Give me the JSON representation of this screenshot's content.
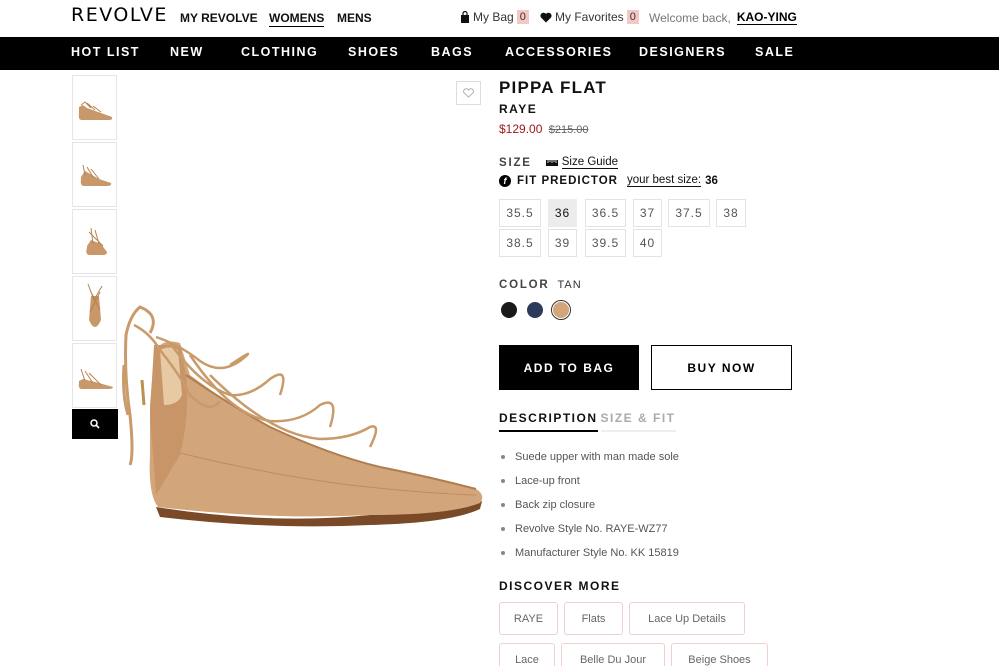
{
  "header": {
    "logo": "REVOLVE",
    "nav": {
      "my_revolve": "MY REVOLVE",
      "womens": "WOMENS",
      "mens": "MENS"
    },
    "bag_label": "My Bag",
    "bag_count": "0",
    "favorites_label": "My Favorites",
    "favorites_count": "0",
    "welcome_text": "Welcome back,",
    "username": "KAO-YING"
  },
  "categories": [
    "HOT LIST",
    "NEW",
    "CLOTHING",
    "SHOES",
    "BAGS",
    "ACCESSORIES",
    "DESIGNERS",
    "SALE"
  ],
  "product": {
    "title": "PIPPA FLAT",
    "brand": "RAYE",
    "sale_price": "$129.00",
    "original_price": "$215.00",
    "size_label": "SIZE",
    "size_guide": "Size Guide",
    "fit_predictor_label": "FIT PREDICTOR",
    "best_size_text": "your best size:",
    "best_size_value": "36",
    "sizes": [
      "35.5",
      "36",
      "36.5",
      "37",
      "37.5",
      "38",
      "38.5",
      "39",
      "39.5",
      "40"
    ],
    "selected_size": "36",
    "color_label": "COLOR",
    "color_value": "TAN",
    "swatches": [
      {
        "name": "black",
        "hex": "#1a1a1a"
      },
      {
        "name": "navy",
        "hex": "#2c3a5c"
      },
      {
        "name": "tan",
        "hex": "#d3a57a"
      }
    ],
    "selected_color": "tan",
    "add_to_bag": "ADD TO BAG",
    "buy_now": "BUY NOW",
    "tabs": [
      "DESCRIPTION",
      "SIZE & FIT"
    ],
    "description": [
      "Suede upper with man made sole",
      "Lace-up front",
      "Back zip closure",
      "Revolve Style No. RAYE-WZ77",
      "Manufacturer Style No. KK 15819"
    ],
    "discover_label": "DISCOVER MORE",
    "discover_tags": [
      "RAYE",
      "Flats",
      "Lace Up Details",
      "Lace",
      "Belle Du Jour",
      "Beige Shoes"
    ]
  },
  "icons": {
    "bag": "bag-icon",
    "heart": "heart-icon",
    "zoom": "magnifier-icon",
    "ruler": "ruler-icon",
    "fit": "fit-predictor-icon"
  },
  "colors": {
    "accent_price": "#a0191f",
    "nav_bg": "#000000",
    "count_bg": "#f4c7c3"
  }
}
